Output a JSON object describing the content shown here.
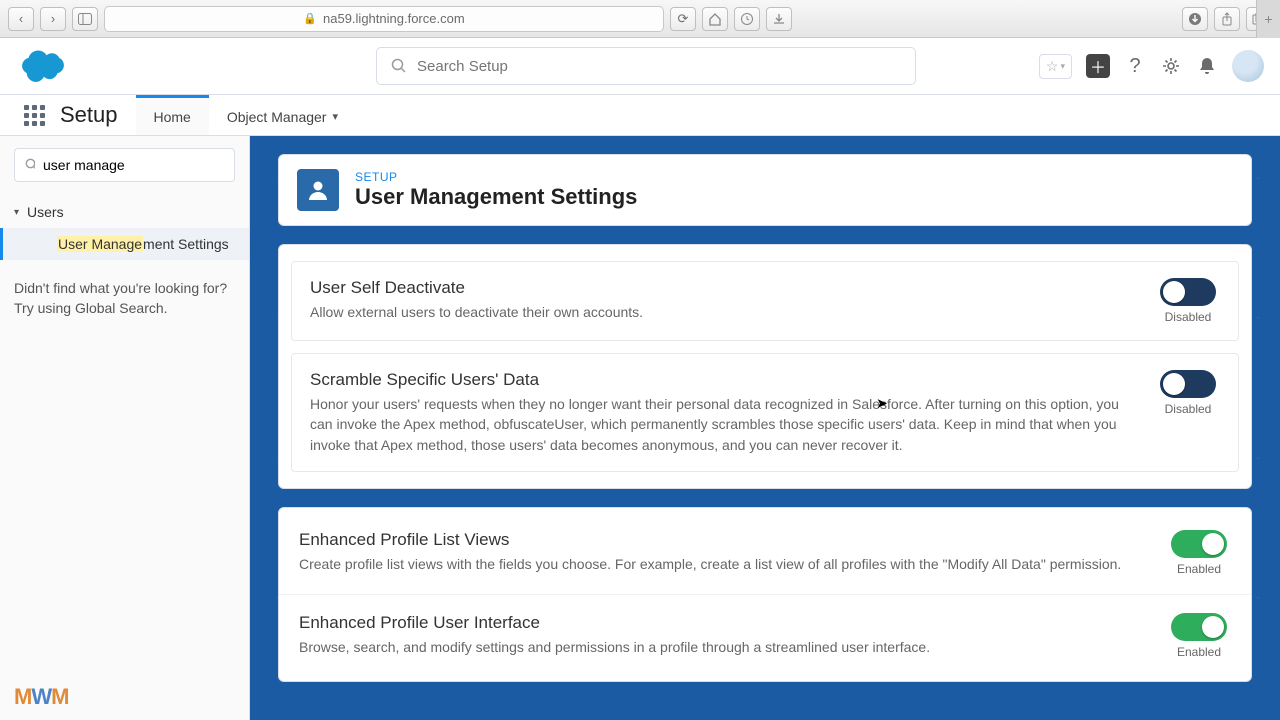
{
  "browser": {
    "url": "na59.lightning.force.com"
  },
  "header": {
    "search_placeholder": "Search Setup"
  },
  "nav": {
    "app_name": "Setup",
    "tabs": {
      "home": "Home",
      "object_manager": "Object Manager"
    }
  },
  "sidebar": {
    "search_value": "user manage",
    "tree_root": "Users",
    "tree_item_prefix": "User Manage",
    "tree_item_suffix": "ment Settings",
    "note_l1": "Didn't find what you're looking for?",
    "note_l2": "Try using Global Search."
  },
  "page": {
    "eyebrow": "SETUP",
    "title": "User Management Settings"
  },
  "toggle_labels": {
    "on": "Enabled",
    "off": "Disabled"
  },
  "settings": {
    "g1": [
      {
        "title": "User Self Deactivate",
        "desc": "Allow external users to deactivate their own accounts.",
        "enabled": false
      },
      {
        "title": "Scramble Specific Users' Data",
        "desc": "Honor your users' requests when they no longer want their personal data recognized in Salesforce. After turning on this option, you can invoke the Apex method, obfuscateUser, which permanently scrambles those specific users' data. Keep in mind that when you invoke that Apex method, those users' data becomes anonymous, and you can never recover it.",
        "enabled": false
      }
    ],
    "g2": [
      {
        "title": "Enhanced Profile List Views",
        "desc": "Create profile list views with the fields you choose. For example, create a list view of all profiles with the \"Modify All Data\" permission.",
        "enabled": true
      },
      {
        "title": "Enhanced Profile User Interface",
        "desc": "Browse, search, and modify settings and permissions in a profile through a streamlined user interface.",
        "enabled": true
      }
    ]
  },
  "watermark": "MWM"
}
